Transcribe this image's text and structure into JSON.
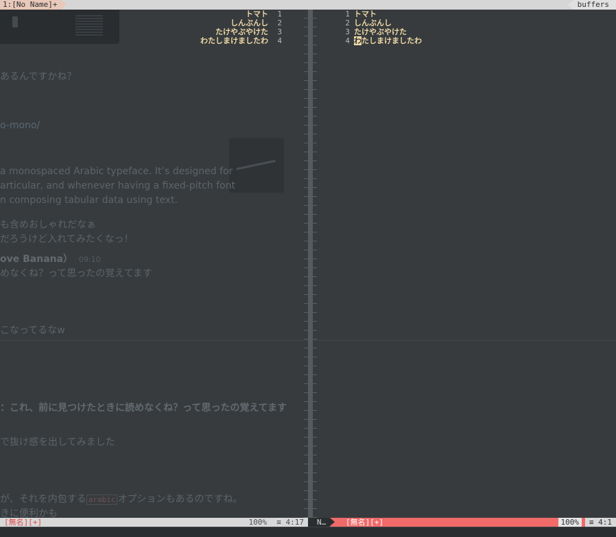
{
  "tabline": {
    "active_tab": "1:[No Name]+",
    "right_label": "buffers"
  },
  "buffer_lines": [
    {
      "num": "1",
      "text": "トマト"
    },
    {
      "num": "2",
      "text": "しんぶんし"
    },
    {
      "num": "3",
      "text": "たけやぶやけた"
    },
    {
      "num": "4",
      "text": "わたしまけましたわ"
    }
  ],
  "cursor_char": "わ",
  "right_line4_rest": "たしまけましたわ",
  "background_chat": {
    "line1": "あるんですかね？",
    "line2": "o-mono/",
    "para1": "a monospaced Arabic typeface. It’s designed for",
    "para2": "articular, and whenever having a fixed-pitch font",
    "para3": "n composing tabular data using text.",
    "line3": "も含めおしゃれだなぁ",
    "line4": "だろうけど入れてみたくなっ！",
    "author": "ove Banana）",
    "time": "09:10",
    "line5": "めなくね？って思ったの覚えてます",
    "line6": "こなってるなw",
    "line7": "：これ、前に見つけたときに読めなくね？って思ったの覚えてます",
    "line8": "で抜け感を出してみました",
    "line9a": "が、それを内包する",
    "code": "arabic",
    "line9b": "オプションもあるのですね。",
    "line10": "きに便利かも"
  },
  "status_left": {
    "modified": "[無名][+]",
    "percent": "100%",
    "position": "≡ 4:17"
  },
  "status_right": {
    "mode": "N…",
    "modified": "[無名][+]",
    "percent": "100%",
    "position": "≡ 4:1"
  },
  "colors": {
    "text": "#efd9a6",
    "status_right_bg": "#f06a6a",
    "bg": "#373b3e"
  }
}
